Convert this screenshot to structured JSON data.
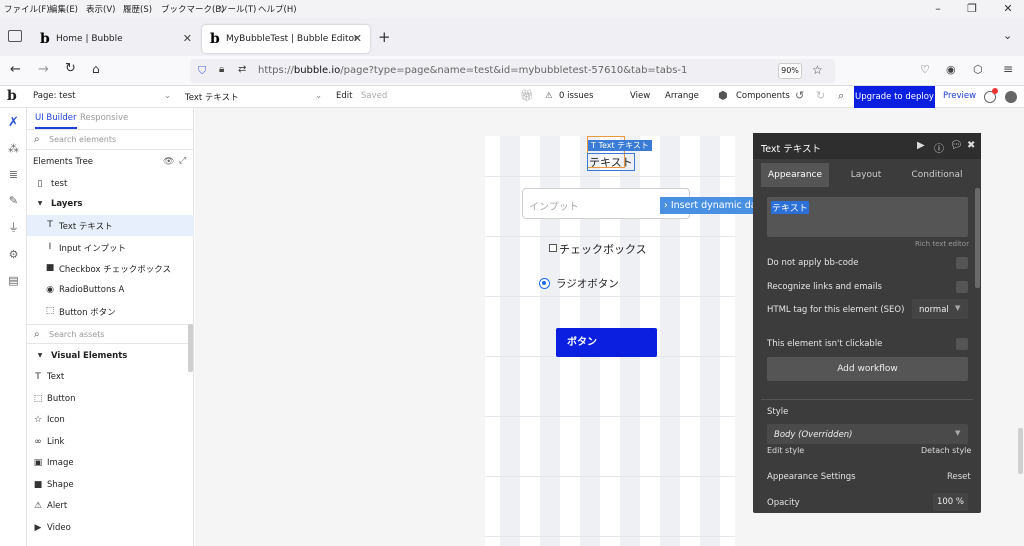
{
  "menu": [
    "ファイル(F)",
    "編集(E)",
    "表示(V)",
    "履歴(S)",
    "ブックマーク(B)",
    "ツール(T)",
    "ヘルプ(H)"
  ],
  "tabs": [
    {
      "icon": "b",
      "title": "Home | Bubble",
      "active": false
    },
    {
      "icon": "b",
      "title": "MyBubbleTest | Bubble Editor",
      "active": true
    }
  ],
  "address": {
    "prefix": "https://",
    "host": "bubble.io",
    "path": "/page?type=page&name=test&id=mybubbletest-57610&tab=tabs-1",
    "zoom": "90%"
  },
  "toolbar": {
    "page_label": "Page: test",
    "element_select": "Text テキスト",
    "edit": "Edit",
    "saved": "Saved",
    "issues": "0 issues",
    "view": "View",
    "arrange": "Arrange",
    "components": "Components",
    "deploy": "Upgrade to deploy",
    "preview": "Preview"
  },
  "sidebar": {
    "tab_builder": "UI Builder",
    "tab_responsive": "Responsive",
    "search_elements": "Search elements",
    "tree_title": "Elements Tree",
    "page_item": "test",
    "layers_label": "Layers",
    "layers": [
      {
        "icon": "T",
        "label": "Text テキスト",
        "selected": true
      },
      {
        "icon": "I",
        "label": "Input インプット",
        "selected": false
      },
      {
        "icon": "■",
        "label": "Checkbox チェックボックス",
        "selected": false
      },
      {
        "icon": "◉",
        "label": "RadioButtons A",
        "selected": false
      },
      {
        "icon": "⬚",
        "label": "Button ボタン",
        "selected": false
      }
    ],
    "search_assets": "Search assets",
    "visual_elements_label": "Visual Elements",
    "visual_elements": [
      {
        "icon": "T",
        "label": "Text"
      },
      {
        "icon": "⬚",
        "label": "Button"
      },
      {
        "icon": "☆",
        "label": "Icon"
      },
      {
        "icon": "∞",
        "label": "Link"
      },
      {
        "icon": "▣",
        "label": "Image"
      },
      {
        "icon": "■",
        "label": "Shape"
      },
      {
        "icon": "⚠",
        "label": "Alert"
      },
      {
        "icon": "▶",
        "label": "Video"
      }
    ]
  },
  "canvas": {
    "text_tag": "Text テキスト",
    "text_value": "テキスト",
    "input_placeholder": "インプット",
    "checkbox_label": "チェックボックス",
    "radio_label": "ラジオボタン",
    "button_label": "ボタン",
    "insert_dynamic": "Insert dynamic data"
  },
  "editor": {
    "title": "Text テキスト",
    "tabs": [
      "Appearance",
      "Layout",
      "Conditional"
    ],
    "content_text": "テキスト",
    "rich_text": "Rich text editor",
    "no_bbcode": "Do not apply bb-code",
    "recognize_links": "Recognize links and emails",
    "html_tag_label": "HTML tag for this element (SEO)",
    "html_tag_value": "normal",
    "not_clickable": "This element isn't clickable",
    "add_workflow": "Add workflow",
    "style_label": "Style",
    "style_value": "Body (Overridden)",
    "edit_style": "Edit style",
    "detach_style": "Detach style",
    "appearance_settings": "Appearance Settings",
    "reset": "Reset",
    "opacity_label": "Opacity",
    "opacity_value": "100",
    "opacity_unit": "%"
  },
  "colors": {
    "accent": "#3a7bd5",
    "deploy": "#0a1fe0",
    "button": "#0a1fe0",
    "editor_bg": "#3c3c3c"
  }
}
